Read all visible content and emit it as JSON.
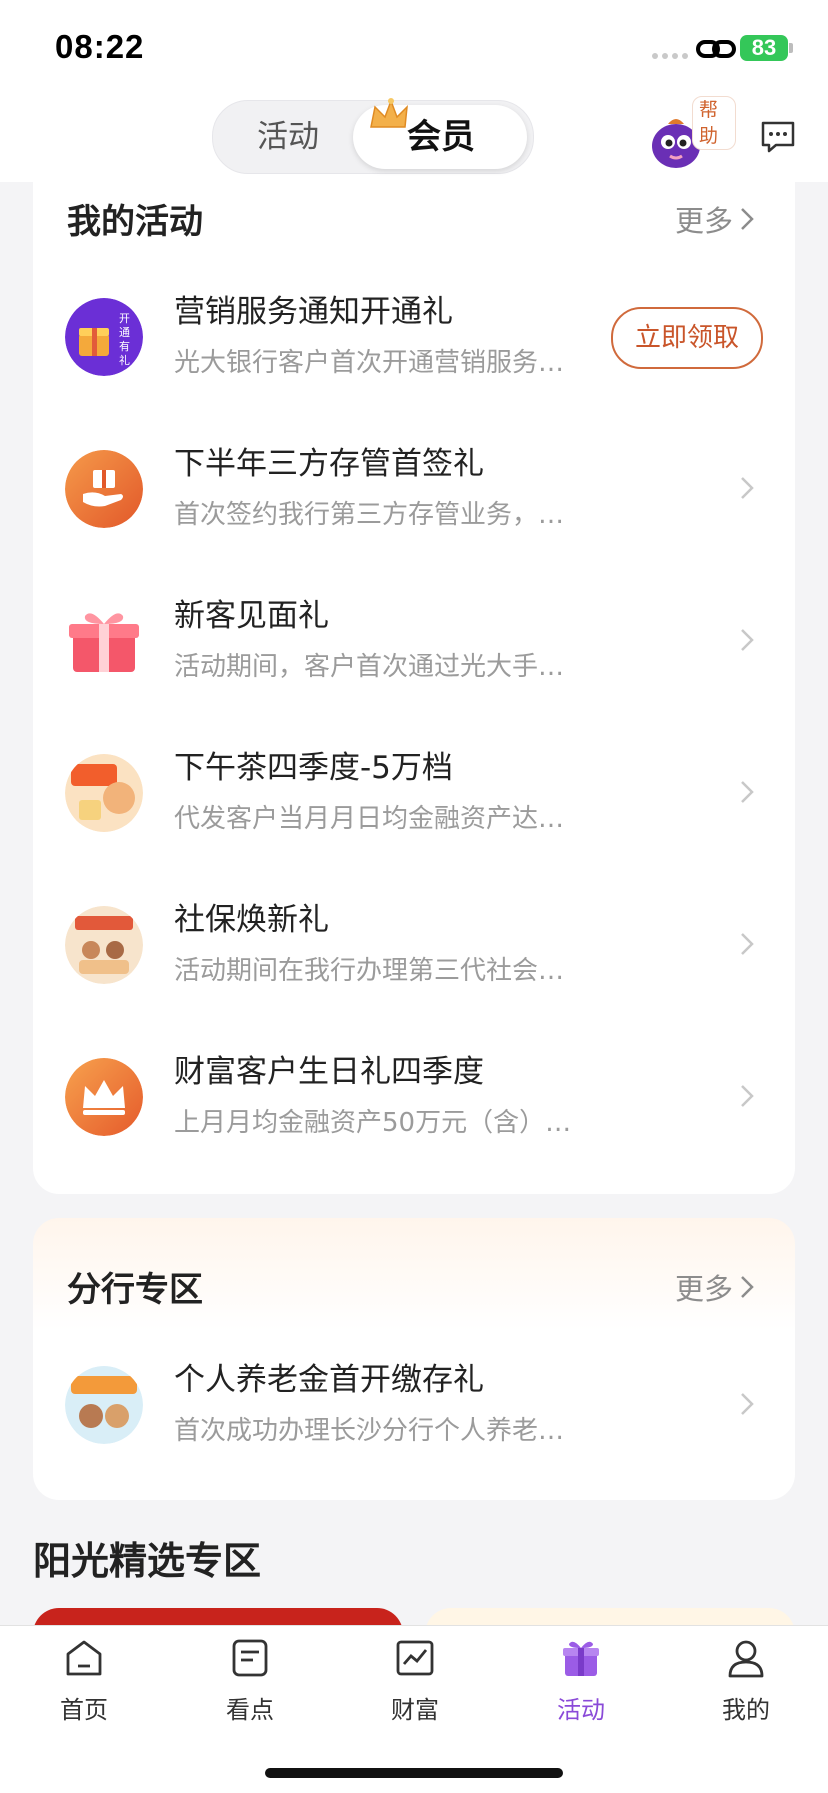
{
  "status_bar": {
    "time": "08:22",
    "battery": "83"
  },
  "header": {
    "tabs": [
      {
        "label": "活动"
      },
      {
        "label": "会员"
      }
    ],
    "help_label": "帮助"
  },
  "my_activities": {
    "title": "我的活动",
    "more_label": "更多",
    "items": [
      {
        "title": "营销服务通知开通礼",
        "desc": "光大银行客户首次开通营销服务…",
        "action": "立即领取",
        "icon_text": "开通有礼"
      },
      {
        "title": "下半年三方存管首签礼",
        "desc": "首次签约我行第三方存管业务，…"
      },
      {
        "title": "新客见面礼",
        "desc": "活动期间，客户首次通过光大手…"
      },
      {
        "title": "下午茶四季度-5万档",
        "desc": "代发客户当月月日均金融资产达…"
      },
      {
        "title": "社保焕新礼",
        "desc": "活动期间在我行办理第三代社会…"
      },
      {
        "title": "财富客户生日礼四季度",
        "desc": "上月月均金融资产50万元（含）…"
      }
    ]
  },
  "branch_zone": {
    "title": "分行专区",
    "more_label": "更多",
    "items": [
      {
        "title": "个人养老金首开缴存礼",
        "desc": "首次成功办理长沙分行个人养老…"
      }
    ]
  },
  "sunny_zone": {
    "title": "阳光精选专区"
  },
  "tab_bar": {
    "items": [
      {
        "label": "首页",
        "icon": "home-icon"
      },
      {
        "label": "看点",
        "icon": "article-icon"
      },
      {
        "label": "财富",
        "icon": "chart-icon"
      },
      {
        "label": "活动",
        "icon": "gift-icon",
        "active": true
      },
      {
        "label": "我的",
        "icon": "person-icon"
      }
    ]
  },
  "colors": {
    "accent": "#8a4ad8",
    "button_border": "#d06a3c",
    "battery": "#34c759"
  }
}
